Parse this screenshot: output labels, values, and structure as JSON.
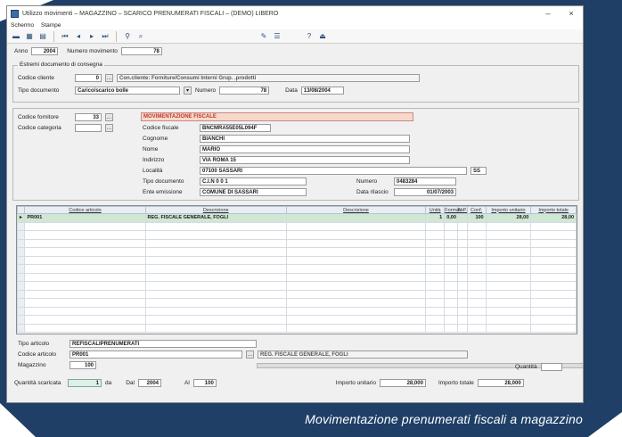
{
  "window": {
    "title": "Utilizzo movimenti – MAGAZZINO – SCARICO PRENUMERATI FISCALI – (DEMO) LIBERO",
    "min": "–",
    "close": "×"
  },
  "menu": {
    "items": [
      "Schermo",
      "Stampe"
    ]
  },
  "top": {
    "anno_label": "Anno",
    "anno_value": "2004",
    "numero_label": "Numero movimento",
    "numero_value": "78"
  },
  "documento": {
    "group_title": "Estremi documento di consegna",
    "codice_label": "Codice cliente",
    "codice_value": "0",
    "codice_desc": "Con.cliente: Forniture/Consumi Interni Grup. .prodotti",
    "tipo_label": "Tipo documento",
    "tipo_value": "Carico/scarico bolle",
    "numero_label": "Numero",
    "numero_value": "78",
    "data_label": "Data",
    "data_value": "13/08/2004"
  },
  "cliente": {
    "codice_label": "Codice fornitore",
    "codice_value": "33",
    "codice2_label": "Codice categoria",
    "codice2_value": "",
    "banner": "MOVIMENTAZIONE FISCALE",
    "fields": [
      {
        "label": "Codice fiscale",
        "value": "BNCMRA55E05L094F"
      },
      {
        "label": "Cognome",
        "value": "BIANCHI"
      },
      {
        "label": "Nome",
        "value": "MARIO"
      },
      {
        "label": "Indirizzo",
        "value": "VIA ROMA 15"
      },
      {
        "label": "Località",
        "value": "07100  SASSARI"
      },
      {
        "label": "Tipo documento",
        "value": "C.I.N 0 0 1"
      },
      {
        "label": "Ente emissione",
        "value": "COMUNE DI SASSARI"
      }
    ],
    "prov": "SS",
    "numero_label": "Numero",
    "numero_value": "0483284",
    "rilascio_label": "Data rilascio",
    "rilascio_value": "01/07/2003"
  },
  "grid": {
    "columns": [
      "Codice articolo",
      "Descrizione",
      "Descrizione",
      "Unità",
      "Formato",
      "N.P.",
      "Conf.",
      "Importo unitario",
      "Importo totale"
    ],
    "rows": [
      {
        "cells": [
          "PR001",
          "REG. FISCALE GENERALE, FOGLI",
          "",
          "1",
          "0,00",
          "",
          "100",
          "28,00",
          "28,00"
        ],
        "selected": true
      },
      {
        "cells": [
          "",
          "",
          "",
          "",
          "",
          "",
          "",
          "",
          ""
        ],
        "selected": false
      },
      {
        "cells": [
          "",
          "",
          "",
          "",
          "",
          "",
          "",
          "",
          ""
        ],
        "selected": false
      },
      {
        "cells": [
          "",
          "",
          "",
          "",
          "",
          "",
          "",
          "",
          ""
        ],
        "selected": false
      },
      {
        "cells": [
          "",
          "",
          "",
          "",
          "",
          "",
          "",
          "",
          ""
        ],
        "selected": false
      },
      {
        "cells": [
          "",
          "",
          "",
          "",
          "",
          "",
          "",
          "",
          ""
        ],
        "selected": false
      },
      {
        "cells": [
          "",
          "",
          "",
          "",
          "",
          "",
          "",
          "",
          ""
        ],
        "selected": false
      },
      {
        "cells": [
          "",
          "",
          "",
          "",
          "",
          "",
          "",
          "",
          ""
        ],
        "selected": false
      },
      {
        "cells": [
          "",
          "",
          "",
          "",
          "",
          "",
          "",
          "",
          ""
        ],
        "selected": false
      },
      {
        "cells": [
          "",
          "",
          "",
          "",
          "",
          "",
          "",
          "",
          ""
        ],
        "selected": false
      },
      {
        "cells": [
          "",
          "",
          "",
          "",
          "",
          "",
          "",
          "",
          ""
        ],
        "selected": false
      },
      {
        "cells": [
          "",
          "",
          "",
          "",
          "",
          "",
          "",
          "",
          ""
        ],
        "selected": false
      },
      {
        "cells": [
          "",
          "",
          "",
          "",
          "",
          "",
          "",
          "",
          ""
        ],
        "selected": false
      },
      {
        "cells": [
          "",
          "",
          "",
          "",
          "",
          "",
          "",
          "",
          ""
        ],
        "selected": false
      }
    ]
  },
  "bottom": {
    "tipo_label": "Tipo articolo",
    "tipo_value": "REFISCALIPRENUMERATI",
    "codice_label": "Codice articolo",
    "codice_value": "PR001",
    "codice_desc": "REG. FISCALE GENERALE, FOGLI",
    "magazzino_label": "Magazzino",
    "magazzino_value": "100",
    "quantita_label": "Quantità",
    "quantita_value": "",
    "qta_scaric_label": "Quantità scaricata",
    "qta_scaric_value": "1",
    "da_label": "da",
    "dal_label": "Dal",
    "dal_value": "2004",
    "al_label": "Al",
    "al_value": "100",
    "imp_unit_label": "Importo unitario",
    "imp_unit_value": "28,000",
    "imp_tot_label": "Importo totale",
    "imp_tot_value": "28,000"
  },
  "caption": "Movimentazione prenumerati fiscali a magazzino",
  "colors": {
    "navy": "#1f3f66",
    "grid_select": "#cfe7d4",
    "banner": "#f6d9c9"
  }
}
